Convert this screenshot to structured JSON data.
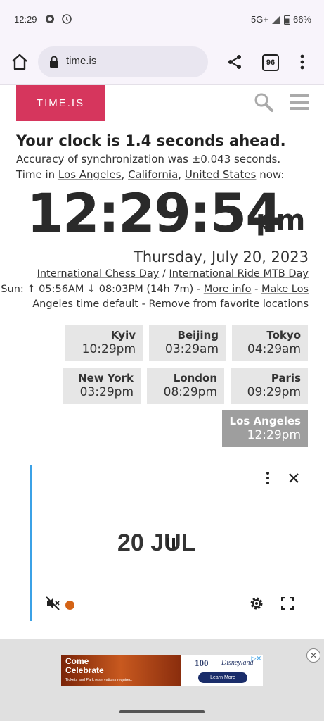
{
  "status_bar": {
    "time": "12:29",
    "network": "5G+",
    "battery": "66%"
  },
  "browser": {
    "url": "time.is",
    "tab_count": "96"
  },
  "site": {
    "logo": "TIME.IS",
    "headline": "Your clock is 1.4 seconds ahead.",
    "accuracy": "Accuracy of synchronization was ±0.043 seconds.",
    "time_in_prefix": "Time in ",
    "city_link": "Los Angeles",
    "state_link": "California",
    "country_link": "United States",
    "now_suffix": " now:",
    "clock": "12:29:54",
    "ampm": "pm",
    "date": "Thursday, July 20, 2023",
    "observances": {
      "day1": "International Chess Day",
      "separator": " / ",
      "day2": "International Ride MTB Day"
    },
    "sun": {
      "text": "Sun: ↑ 05:56AM ↓ 08:03PM (14h 7m) - ",
      "more_info": "More info",
      "dash": " - ",
      "make_default_1": "Make Los",
      "make_default_2": "Angeles time default",
      "remove": "Remove from favorite locations"
    },
    "cities": [
      {
        "name": "Kyiv",
        "time": "10:29pm"
      },
      {
        "name": "Beijing",
        "time": "03:29am"
      },
      {
        "name": "Tokyo",
        "time": "04:29am"
      },
      {
        "name": "New York",
        "time": "03:29pm"
      },
      {
        "name": "London",
        "time": "08:29pm"
      },
      {
        "name": "Paris",
        "time": "09:29pm"
      },
      {
        "name": "Los Angeles",
        "time": "12:29pm"
      }
    ]
  },
  "video_ad": {
    "text": "20 JUL"
  },
  "banner_ad": {
    "headline_1": "Come",
    "headline_2": "Celebrate",
    "fineprint": "Tickets and Park reservations required.",
    "brand_100": "100",
    "brand_name": "Disneyland",
    "cta": "Learn More",
    "close": "✕"
  },
  "colors": {
    "logo_bg": "#d6365d",
    "video_accent": "#3ba1e6",
    "active_tile": "#9e9e9e"
  }
}
